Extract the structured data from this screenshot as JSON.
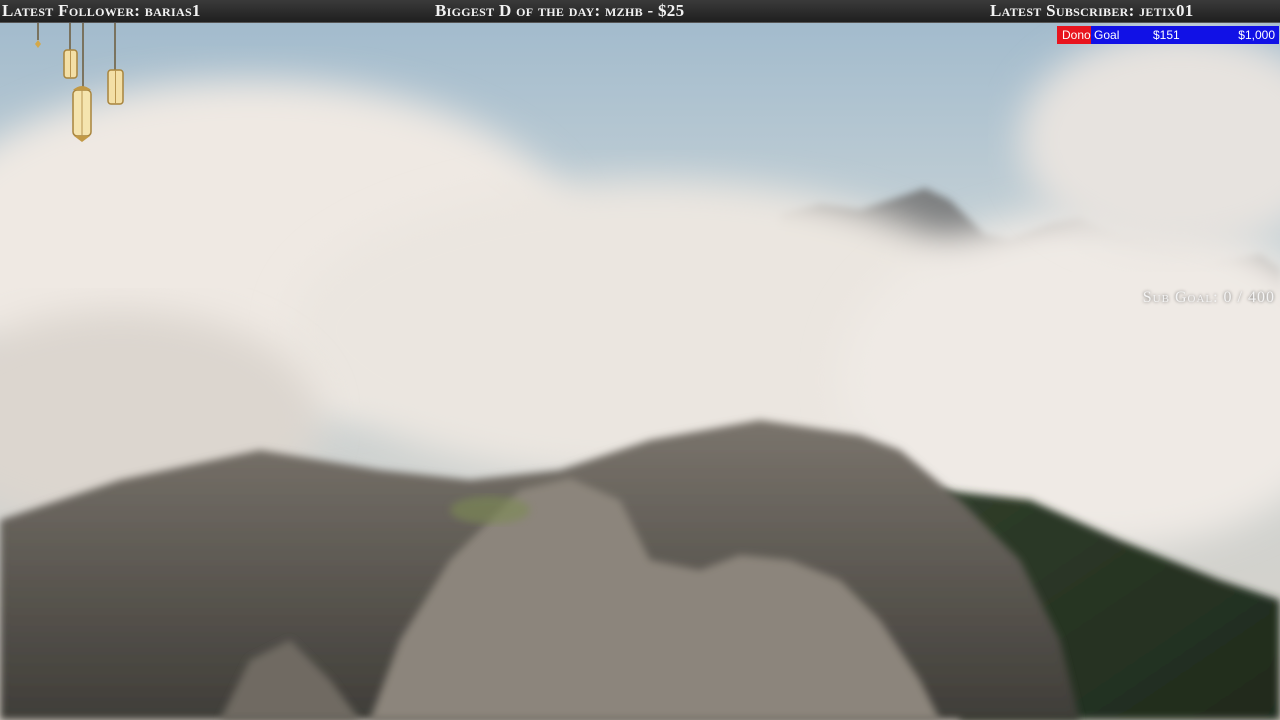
{
  "topbar": {
    "latest_follower": "Latest Follower: barias1",
    "biggest_donation": "Biggest D of the day: mzhb - $25",
    "latest_subscriber": "Latest Subscriber: jetix01"
  },
  "dono_goal": {
    "label": "Dono Goal",
    "current": "$151",
    "target": "$1,000",
    "progress_fraction": 0.151,
    "colors": {
      "filled": "#e8141e",
      "remaining": "#1111e6"
    }
  },
  "sub_goal": {
    "text": "Sub Goal: 0 / 400"
  },
  "decoration": {
    "lanterns_icon": "hanging-lanterns-icon",
    "background": "mountain-peaks-above-clouds"
  }
}
